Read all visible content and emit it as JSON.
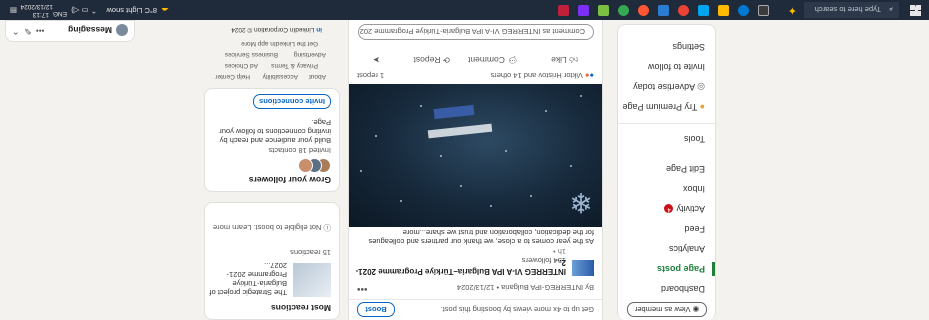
{
  "taskbar": {
    "search_placeholder": "Type here to search",
    "weather": "8°C Light snow",
    "time": "17:13",
    "date": "12/13/2024",
    "lang": "ENG",
    "colors": [
      "#0078d4",
      "#ffb900",
      "#00a4ef",
      "#ea4335",
      "#34a853",
      "#7b2ff7",
      "#ff5733",
      "#c21f3b"
    ]
  },
  "left_nav": {
    "view_as_member": "View as member",
    "items": [
      "Dashboard",
      "Page posts",
      "Analytics",
      "Feed",
      "Activity",
      "Inbox",
      "Edit Page",
      "Tools"
    ],
    "activity_count": "4",
    "premium": "Try Premium Page",
    "advertise": "Advertise today",
    "invite": "Invite to follow",
    "settings": "Settings"
  },
  "feed": {
    "boost_prompt": "Get up to 4x more views by boosting this post.",
    "boost_label": "Boost",
    "author_line": "By INTERREG-IPA Bulgaria • 12/13/2024",
    "org_name": "INTERREG VI-A IPA Bulgaria–Türkiye Programme 2021-2...",
    "followers": "154 followers",
    "time": "1h •",
    "caption": "As the year comes to a close, we thank our partners and colleagues for the dedication, collaboration and trust we share...more",
    "reactions": "Viktor Hristov and 14 others",
    "reposts": "1 repost",
    "actions": [
      "Like",
      "Comment",
      "Repost",
      "Send"
    ],
    "comment_placeholder": "Comment as INTERREG VI-A IPA Bulgaria-Türkiye Programme 2021-2027..."
  },
  "right": {
    "most_reactions_title": "Most reactions",
    "most_reactions_item": "The Strategic project of Bulgaria-Türkiye Programme 2021-2027...",
    "most_reactions_meta": "15 reactions",
    "boost_eligible": "Not eligible to boost. Learn more",
    "grow_title": "Grow your followers",
    "grow_meta": "Invited 18 contacts",
    "grow_body": "Build your audience and reach by inviting connections to follow your Page.",
    "invite_btn": "Invite connections",
    "footer_links": [
      "About",
      "Accessibility",
      "Help Center",
      "Privacy & Terms",
      "Ad Choices",
      "Advertising",
      "Business Services",
      "Get the LinkedIn app",
      "More"
    ],
    "footer_brand": "LinkedIn Corporation © 2024"
  },
  "messaging": {
    "label": "Messaging"
  }
}
